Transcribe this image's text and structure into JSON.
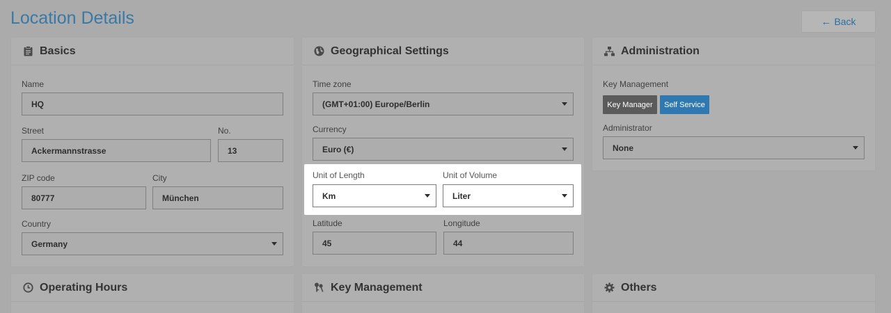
{
  "page": {
    "title": "Location Details",
    "back_label": "Back"
  },
  "basics": {
    "title": "Basics",
    "name_label": "Name",
    "name_value": "HQ",
    "street_label": "Street",
    "street_value": "Ackermannstrasse",
    "no_label": "No.",
    "no_value": "13",
    "zip_label": "ZIP code",
    "zip_value": "80777",
    "city_label": "City",
    "city_value": "München",
    "country_label": "Country",
    "country_value": "Germany"
  },
  "geo": {
    "title": "Geographical Settings",
    "timezone_label": "Time zone",
    "timezone_value": "(GMT+01:00) Europe/Berlin",
    "currency_label": "Currency",
    "currency_value": "Euro (€)",
    "length_label": "Unit of Length",
    "length_value": "Km",
    "volume_label": "Unit of Volume",
    "volume_value": "Liter",
    "latitude_label": "Latitude",
    "latitude_value": "45",
    "longitude_label": "Longitude",
    "longitude_value": "44"
  },
  "admin": {
    "title": "Administration",
    "key_mgmt_label": "Key Management",
    "key_manager_btn": "Key Manager",
    "self_service_btn": "Self Service",
    "administrator_label": "Administrator",
    "administrator_value": "None"
  },
  "bottom": {
    "operating_hours": "Operating Hours",
    "key_management": "Key Management",
    "others": "Others"
  },
  "colors": {
    "accent": "#3a78a6",
    "self_service_bg": "#2f79b0",
    "key_manager_bg": "#5b5b5b",
    "overlay_bg": "#ababab"
  },
  "icons": {
    "basics": "clipboard-icon",
    "geo": "globe-icon",
    "admin": "sitemap-icon",
    "operating_hours": "clock-icon",
    "key_management": "keys-icon",
    "others": "gear-icon",
    "back": "arrow-left-icon"
  }
}
